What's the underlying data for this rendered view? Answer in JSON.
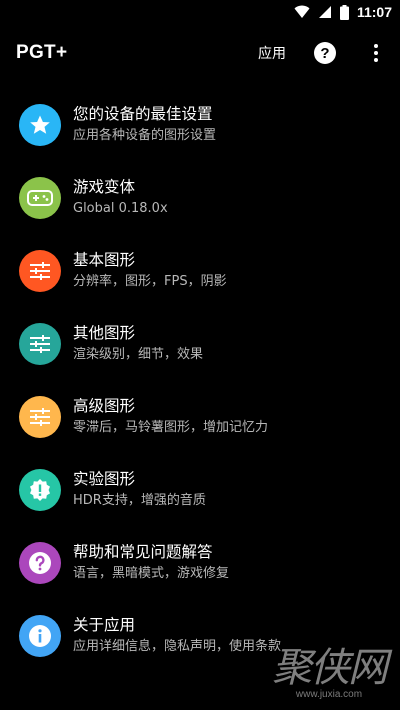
{
  "status_bar": {
    "time": "11:07"
  },
  "app_bar": {
    "title": "PGT+",
    "apply_label": "应用",
    "help_glyph": "?"
  },
  "menu": [
    {
      "title": "您的设备的最佳设置",
      "subtitle": "应用各种设备的图形设置",
      "icon": "star-icon",
      "color": "#29b6f6"
    },
    {
      "title": "游戏变体",
      "subtitle": "Global 0.18.0x",
      "icon": "gamepad-icon",
      "color": "#8bc34a"
    },
    {
      "title": "基本图形",
      "subtitle": "分辨率，图形，FPS，阴影",
      "icon": "sliders-icon",
      "color": "#ff5722"
    },
    {
      "title": "其他图形",
      "subtitle": "渲染级别，细节，效果",
      "icon": "sliders-icon",
      "color": "#26a69a"
    },
    {
      "title": "高级图形",
      "subtitle": "零滞后，马铃薯图形，增加记忆力",
      "icon": "sliders-icon",
      "color": "#ffb74d"
    },
    {
      "title": "实验图形",
      "subtitle": "HDR支持，增强的音质",
      "icon": "alert-badge-icon",
      "color": "#26c6a6"
    },
    {
      "title": "帮助和常见问题解答",
      "subtitle": "语言，黑暗模式，游戏修复",
      "icon": "help-icon",
      "color": "#ab47bc"
    },
    {
      "title": "关于应用",
      "subtitle": "应用详细信息，隐私声明，使用条款",
      "icon": "info-icon",
      "color": "#42a5f5"
    }
  ],
  "watermark": {
    "text": "聚侠网",
    "url": "www.juxia.com"
  }
}
